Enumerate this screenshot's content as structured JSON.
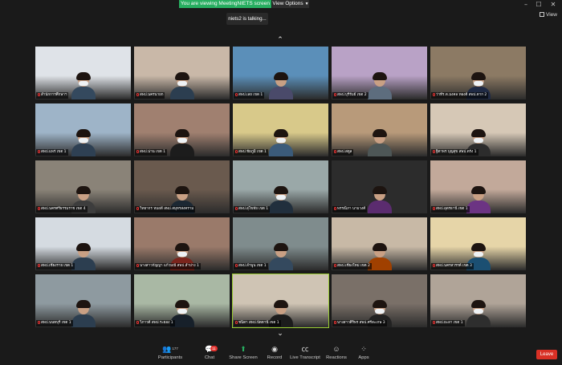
{
  "banner": {
    "viewing_text": "You are viewing MeetingNIETS screen",
    "view_options_label": "View Options"
  },
  "window": {
    "minimize": "–",
    "maximize": "☐",
    "close": "✕"
  },
  "view_label": "View",
  "talking": "niets2 is talking...",
  "tiles": [
    {
      "name": "สำนักการศึกษาฯ",
      "bg": "#dfe3e8",
      "shirt": "#34495e",
      "mask": true,
      "active": false
    },
    {
      "name": "สพป.นครนายก",
      "bg": "#c9b8a8",
      "shirt": "#2c3e50",
      "mask": true,
      "active": false
    },
    {
      "name": "สพป.เลย เขต 1",
      "bg": "#5b8fb9",
      "shirt": "#4a4a6a",
      "mask": false,
      "active": false
    },
    {
      "name": "สพป.บุรีรัมย์ เขต 2",
      "bg": "#b9a2c6",
      "shirt": "#5d6d7e",
      "mask": false,
      "active": false
    },
    {
      "name": "ว่าที่ร.ต.มงคล ทองดี สพป.ตาก 2",
      "bg": "#8c7a64",
      "shirt": "#1f2a44",
      "mask": true,
      "active": false
    },
    {
      "name": "สพป.แพร่ เขต 1",
      "bg": "#9eb4c8",
      "shirt": "#2e4053",
      "mask": true,
      "active": false
    },
    {
      "name": "สพป.น่าน เขต 1",
      "bg": "#a08070",
      "shirt": "#1c1c1c",
      "mask": true,
      "active": false
    },
    {
      "name": "สพป.ชัยภูมิ เขต 1",
      "bg": "#d8c98a",
      "shirt": "#3b5b7a",
      "mask": true,
      "active": false
    },
    {
      "name": "สพป.สตูล",
      "bg": "#b89a7a",
      "shirt": "#4d5656",
      "mask": false,
      "active": false
    },
    {
      "name": "ฐิตาพร บุญสุข สพป.ตรัง 1",
      "bg": "#d6c8b6",
      "shirt": "#2c2c2c",
      "mask": true,
      "active": false
    },
    {
      "name": "สพป.นครศรีธรรมราช เขต 4",
      "bg": "#8a8378",
      "shirt": "#3d3d3d",
      "mask": false,
      "active": false
    },
    {
      "name": "วิทยากร หมอดี สพป.สมุทรสงคราม",
      "bg": "#6a5a4e",
      "shirt": "#1c2833",
      "mask": false,
      "active": false
    },
    {
      "name": "สพป.สุโขทัย เขต 1",
      "bg": "#9aa8a8",
      "shirt": "#212f3d",
      "mask": true,
      "active": false
    },
    {
      "name": "พรรณิภา นามวงศ์",
      "bg": "#2c2c2c",
      "shirt": "#5b2c6f",
      "mask": false,
      "active": false
    },
    {
      "name": "สพป.อุดรธานี เขต 1",
      "bg": "#c2a99a",
      "shirt": "#6c3483",
      "mask": false,
      "active": false
    },
    {
      "name": "สพป.เชียงราย เขต 1",
      "bg": "#d5dbe1",
      "shirt": "#2c3e50",
      "mask": false,
      "active": false
    },
    {
      "name": "นางสาวกัญญา แก้วมณี สพป.ลำปาง 1",
      "bg": "#9a7a6a",
      "shirt": "#7b241c",
      "mask": true,
      "active": false
    },
    {
      "name": "สพป.ลำพูน เขต 1",
      "bg": "#7f8c8d",
      "shirt": "#34495e",
      "mask": false,
      "active": false
    },
    {
      "name": "สพป.เชียงใหม่ เขต 2",
      "bg": "#c8b9a6",
      "shirt": "#a04000",
      "mask": false,
      "active": false
    },
    {
      "name": "สพป.นครสวรรค์ เขต 3",
      "bg": "#e6d5a8",
      "shirt": "#1b4f72",
      "mask": true,
      "active": false
    },
    {
      "name": "สพป.นนทบุรี เขต 1",
      "bg": "#8e9aa0",
      "shirt": "#2c3e50",
      "mask": false,
      "active": false
    },
    {
      "name": "วิภาวดี สพป.ระยอง 1",
      "bg": "#a9b8a4",
      "shirt": "#17202a",
      "mask": true,
      "active": false
    },
    {
      "name": "ชนิดา สพป.ปัตตานี เขต 1",
      "bg": "#cfc4b4",
      "shirt": "#1c1c1c",
      "mask": false,
      "active": true
    },
    {
      "name": "นางสาวศิริพร สพป.ศรีสะเกษ 3",
      "bg": "#7a7068",
      "shirt": "#222222",
      "mask": true,
      "active": false
    },
    {
      "name": "สพป.ยะลา เขต 1",
      "bg": "#b0a498",
      "shirt": "#2e2e2e",
      "mask": true,
      "active": false
    }
  ],
  "toolbar": {
    "participants_label": "Participants",
    "participants_count": "177",
    "chat_label": "Chat",
    "chat_badge": "11",
    "share_label": "Share Screen",
    "record_label": "Record",
    "transcript_label": "Live Transcript",
    "reactions_label": "Reactions",
    "apps_label": "Apps",
    "leave_label": "Leave"
  }
}
